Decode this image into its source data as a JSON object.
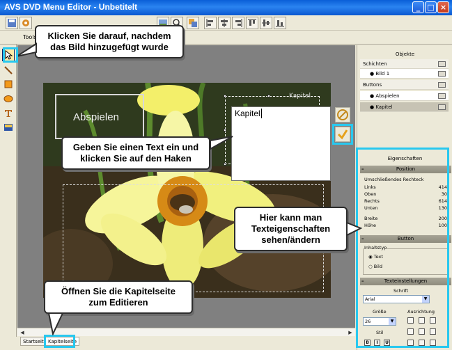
{
  "window": {
    "title": "AVS DVD Menu Editor - Unbetitelt",
    "minimize": "_",
    "maximize": "□",
    "close": "×"
  },
  "subbar": {
    "tools_tab": "Tools"
  },
  "callouts": {
    "top": [
      "Klicken Sie darauf, nachdem",
      "das Bild hinzugefügt wurde"
    ],
    "middle": [
      "Geben Sie einen Text ein und",
      "klicken Sie auf den Haken"
    ],
    "right": [
      "Hier kann man",
      "Texteigenschaften",
      "sehen/ändern"
    ],
    "bottom": [
      "Öffnen Sie die Kapitelseite",
      "zum Editieren"
    ]
  },
  "canvas": {
    "play_button_label": "Abspielen",
    "text_input_value": "Kapitel",
    "cut_label": "Kapitel"
  },
  "page_tabs": [
    "Startseite",
    "Kapitelseite"
  ],
  "objects_panel": {
    "title": "Objekte",
    "layers_header": "Schichten",
    "layers": [
      "Bild 1"
    ],
    "buttons_header": "Buttons",
    "buttons": [
      "Abspielen",
      "Kapitel"
    ]
  },
  "properties_panel": {
    "title": "Eigenschaften",
    "position": {
      "header": "Position",
      "group_label": "Umschließendes Rechteck",
      "fields": [
        {
          "label": "Links",
          "value": "414"
        },
        {
          "label": "Oben",
          "value": "30"
        },
        {
          "label": "Rechts",
          "value": "614"
        },
        {
          "label": "Unten",
          "value": "130"
        },
        {
          "label": "Breite",
          "value": "200"
        },
        {
          "label": "Höhe",
          "value": "100"
        }
      ]
    },
    "button": {
      "header": "Button",
      "group_label": "Inhaltstyp",
      "options": [
        "Text",
        "Bild"
      ],
      "selected": "Text"
    },
    "text_settings": {
      "header": "Texteinstellungen",
      "font_label": "Schrift",
      "font_value": "Arial",
      "size_label": "Größe",
      "size_value": "26",
      "align_label": "Ausrichtung",
      "style_label": "Stil",
      "style_buttons": [
        "B",
        "I",
        "U"
      ]
    }
  },
  "colors": {
    "highlight": "#28c8ef",
    "titlebar": "#0a5fd8",
    "panel": "#ece9d8"
  }
}
